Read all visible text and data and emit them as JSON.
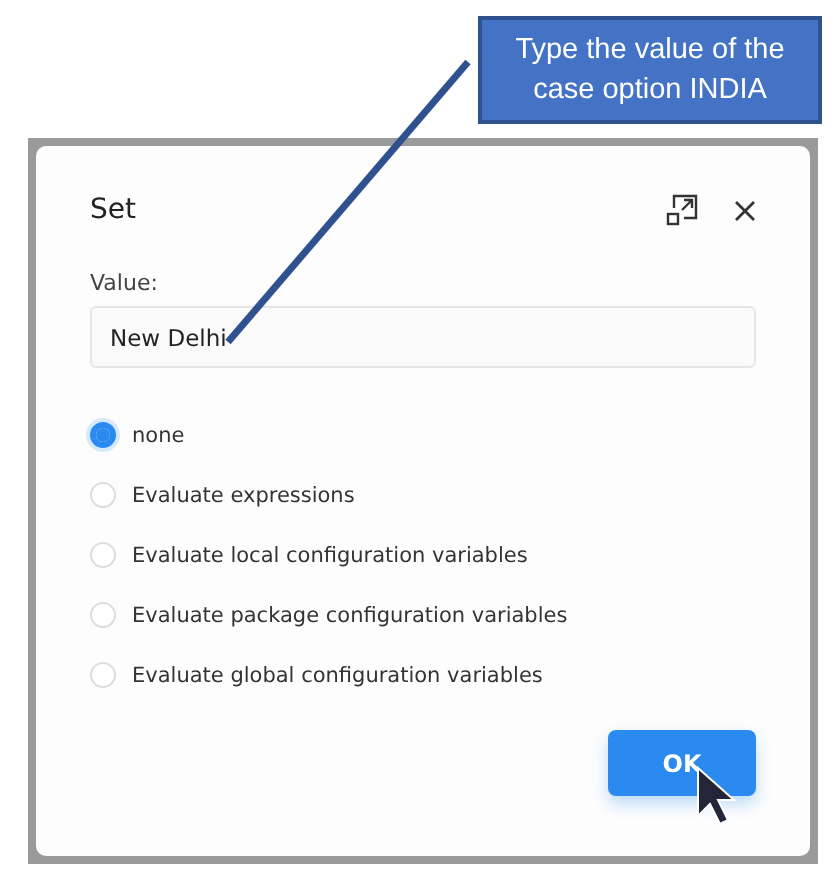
{
  "callout": {
    "text": "Type the value of the case option INDIA"
  },
  "dialog": {
    "title": "Set",
    "value_label": "Value:",
    "value": "New Delhi",
    "options": [
      {
        "label": "none",
        "selected": true
      },
      {
        "label": "Evaluate expressions",
        "selected": false
      },
      {
        "label": "Evaluate local configuration variables",
        "selected": false
      },
      {
        "label": "Evaluate package configuration variables",
        "selected": false
      },
      {
        "label": "Evaluate global configuration variables",
        "selected": false
      }
    ],
    "ok_button": "OK"
  }
}
